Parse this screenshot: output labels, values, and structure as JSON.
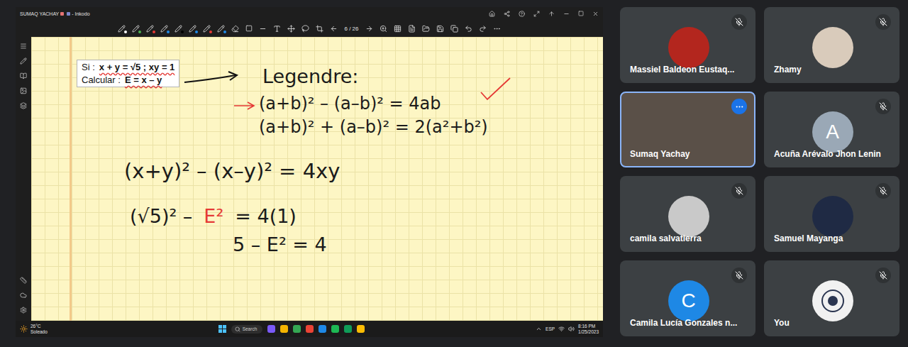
{
  "shared_screen": {
    "window": {
      "title": "SUMAQ YACHAY",
      "suffix": "- Inkodo"
    },
    "toolbar": {
      "page": "6 / 26"
    },
    "canvas": {
      "problem": [
        {
          "label": "Si :",
          "expr": "x + y = √5 ; xy = 1"
        },
        {
          "label": "Calcular :",
          "expr": "E = x – y"
        }
      ],
      "heading": "Legendre:",
      "lines": [
        {
          "marked": true,
          "segments": [
            {
              "text": "(a+b)² – (a–b)² = 4ab",
              "color": "#1b1b1b"
            }
          ]
        },
        {
          "marked": false,
          "segments": [
            {
              "text": "(a+b)² + (a–b)² = 2(a²+b²)",
              "color": "#1b1b1b"
            }
          ]
        },
        {
          "marked": false,
          "segments": [
            {
              "text": "(x+y)² – (x–y)² = 4xy",
              "color": "#1b1b1b"
            }
          ]
        },
        {
          "marked": false,
          "segments": [
            {
              "text": "(√5)² –",
              "color": "#1b1b1b"
            },
            {
              "text": "E²",
              "color": "#e53935"
            },
            {
              "text": "= 4(1)",
              "color": "#1b1b1b"
            }
          ]
        },
        {
          "marked": false,
          "segments": [
            {
              "text": "5 – E² = 4",
              "color": "#1b1b1b"
            }
          ]
        }
      ]
    },
    "taskbar": {
      "temperature": "26°C",
      "weather": "Soleado",
      "search": "Search",
      "language": "ESP",
      "time": "8:16 PM",
      "date": "1/25/2023"
    }
  },
  "participants": [
    {
      "name": "Massiel Baldeon Eustaq...",
      "kind": "photo",
      "initial": "",
      "color": "#b3261e",
      "muted": true,
      "selected": false
    },
    {
      "name": "Zhamy",
      "kind": "photo",
      "initial": "",
      "color": "#d9cbbb",
      "muted": true,
      "selected": false
    },
    {
      "name": "Sumaq Yachay",
      "kind": "video",
      "initial": "",
      "color": "#5a5048",
      "muted": false,
      "selected": true
    },
    {
      "name": "Acuña Arévalo Jhon Lenin",
      "kind": "letter",
      "initial": "A",
      "color": "#9aa8b6",
      "muted": true,
      "selected": false
    },
    {
      "name": "camila salvatierra",
      "kind": "photo",
      "initial": "",
      "color": "#c9c9c9",
      "muted": true,
      "selected": false
    },
    {
      "name": "Samuel Mayanga",
      "kind": "photo",
      "initial": "",
      "color": "#1f2a44",
      "muted": true,
      "selected": false
    },
    {
      "name": "Camila Lucía Gonzales n...",
      "kind": "letter",
      "initial": "C",
      "color": "#1e88e5",
      "muted": true,
      "selected": false
    },
    {
      "name": "You",
      "kind": "logo",
      "initial": "",
      "color": "#f1f1f1",
      "muted": true,
      "selected": false
    }
  ]
}
